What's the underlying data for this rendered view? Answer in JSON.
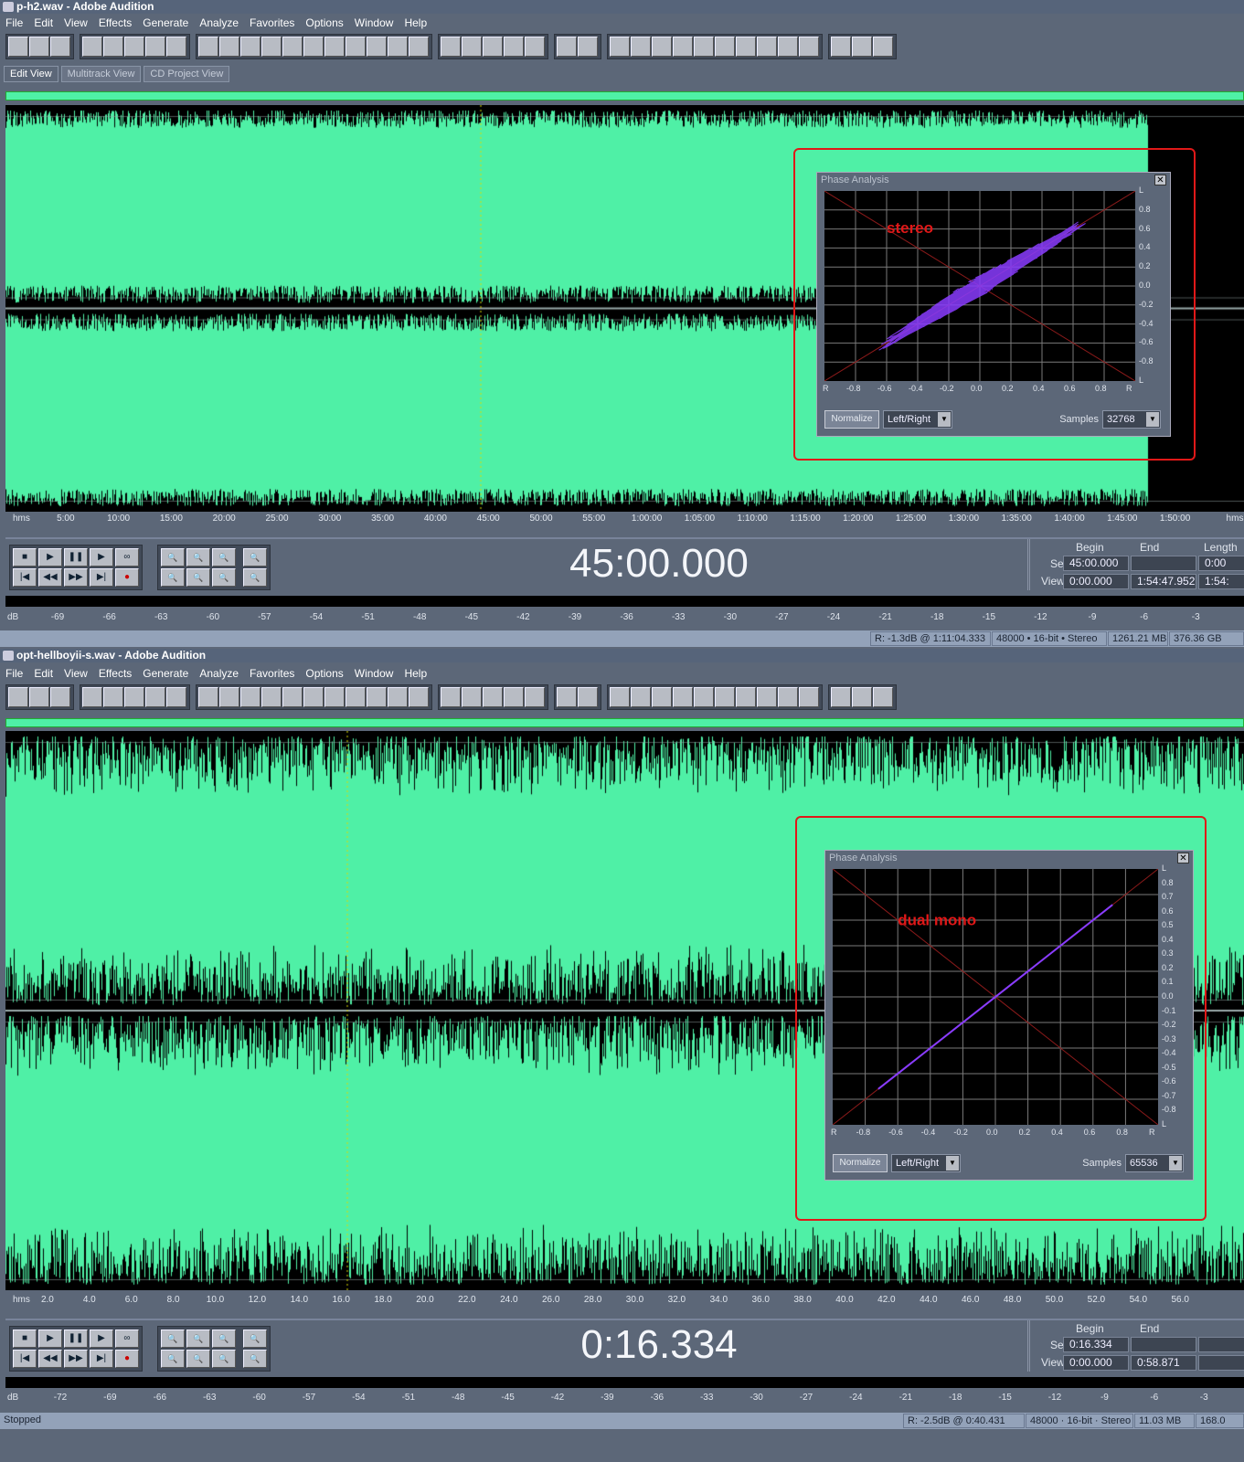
{
  "menu": [
    "File",
    "Edit",
    "View",
    "Effects",
    "Generate",
    "Analyze",
    "Favorites",
    "Options",
    "Window",
    "Help"
  ],
  "colors": {
    "wave": "#4ff0a6",
    "waveBg": "#000000",
    "phaseTrace": "#8a3cff",
    "annotation": "#e01818"
  },
  "windows": [
    {
      "title": "p-h2.wav - Adobe Audition",
      "tabs": [
        "Edit View",
        "Multitrack View",
        "CD Project View"
      ],
      "timeline": [
        "hms",
        "5:00",
        "10:00",
        "15:00",
        "20:00",
        "25:00",
        "30:00",
        "35:00",
        "40:00",
        "45:00",
        "50:00",
        "55:00",
        "1:00:00",
        "1:05:00",
        "1:10:00",
        "1:15:00",
        "1:20:00",
        "1:25:00",
        "1:30:00",
        "1:35:00",
        "1:40:00",
        "1:45:00",
        "1:50:00",
        "hms"
      ],
      "time": "45:00.000",
      "sel": {
        "begin_label": "Begin",
        "end_label": "End",
        "length_label": "Length",
        "sel_label": "Sel",
        "view_label": "View",
        "sel_begin": "45:00.000",
        "sel_end": "",
        "sel_length": "0:00",
        "view_begin": "0:00.000",
        "view_end": "1:54:47.952",
        "view_length": "1:54:"
      },
      "db": [
        "dB",
        "-69",
        "-66",
        "-63",
        "-60",
        "-57",
        "-54",
        "-51",
        "-48",
        "-45",
        "-42",
        "-39",
        "-36",
        "-33",
        "-30",
        "-27",
        "-24",
        "-21",
        "-18",
        "-15",
        "-12",
        "-9",
        "-6",
        "-3"
      ],
      "status": {
        "state": "",
        "peak": "R: -1.3dB @ 1:11:04.333",
        "format": "48000 • 16-bit • Stereo",
        "size": "1261.21 MB",
        "free": "376.36 GB"
      },
      "phase": {
        "title": "Phase Analysis",
        "annotation": "stereo",
        "yticks": [
          "L",
          "0.8",
          "0.6",
          "0.4",
          "0.2",
          "0.0",
          "-0.2",
          "-0.4",
          "-0.6",
          "-0.8",
          "L"
        ],
        "xticks": [
          "R",
          "-0.8",
          "-0.6",
          "-0.4",
          "-0.2",
          "0.0",
          "0.2",
          "0.4",
          "0.6",
          "0.8",
          "R"
        ],
        "normalize": "Normalize",
        "mode": "Left/Right",
        "samples_label": "Samples",
        "samples": "32768",
        "correlation": "wide"
      }
    },
    {
      "title": "opt-hellboyii-s.wav - Adobe Audition",
      "tabs": [],
      "timeline": [
        "hms",
        "2.0",
        "4.0",
        "6.0",
        "8.0",
        "10.0",
        "12.0",
        "14.0",
        "16.0",
        "18.0",
        "20.0",
        "22.0",
        "24.0",
        "26.0",
        "28.0",
        "30.0",
        "32.0",
        "34.0",
        "36.0",
        "38.0",
        "40.0",
        "42.0",
        "44.0",
        "46.0",
        "48.0",
        "50.0",
        "52.0",
        "54.0",
        "56.0"
      ],
      "time": "0:16.334",
      "sel": {
        "begin_label": "Begin",
        "end_label": "End",
        "length_label": "",
        "sel_label": "Sel",
        "view_label": "View",
        "sel_begin": "0:16.334",
        "sel_end": "",
        "sel_length": "",
        "view_begin": "0:00.000",
        "view_end": "0:58.871",
        "view_length": ""
      },
      "db": [
        "dB",
        "-72",
        "-69",
        "-66",
        "-63",
        "-60",
        "-57",
        "-54",
        "-51",
        "-48",
        "-45",
        "-42",
        "-39",
        "-36",
        "-33",
        "-30",
        "-27",
        "-24",
        "-21",
        "-18",
        "-15",
        "-12",
        "-9",
        "-6",
        "-3"
      ],
      "status": {
        "state": "Stopped",
        "peak": "R: -2.5dB @  0:40.431",
        "format": "48000 · 16-bit · Stereo",
        "size": "11.03 MB",
        "free": "168.0"
      },
      "phase": {
        "title": "Phase Analysis",
        "annotation": "dual mono",
        "yticks": [
          "L",
          "0.8",
          "0.7",
          "0.6",
          "0.5",
          "0.4",
          "0.3",
          "0.2",
          "0.1",
          "0.0",
          "-0.1",
          "-0.2",
          "-0.3",
          "-0.4",
          "-0.5",
          "-0.6",
          "-0.7",
          "-0.8",
          "L"
        ],
        "xticks": [
          "R",
          "-0.8",
          "-0.6",
          "-0.4",
          "-0.2",
          "0.0",
          "0.2",
          "0.4",
          "0.6",
          "0.8",
          "R"
        ],
        "normalize": "Normalize",
        "mode": "Left/Right",
        "samples_label": "Samples",
        "samples": "65536",
        "correlation": "mono"
      }
    }
  ]
}
